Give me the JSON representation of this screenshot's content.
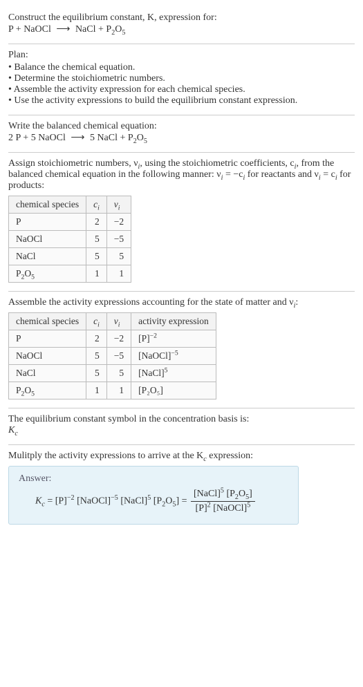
{
  "intro": {
    "line1": "Construct the equilibrium constant, K, expression for:",
    "eq_lhs1": "P",
    "eq_plus": " + ",
    "eq_lhs2": "NaOCl",
    "arrow": "⟶",
    "eq_rhs1": "NaCl",
    "eq_rhs2_a": "P",
    "eq_rhs2_b": "O"
  },
  "plan": {
    "title": "Plan:",
    "items": [
      "• Balance the chemical equation.",
      "• Determine the stoichiometric numbers.",
      "• Assemble the activity expression for each chemical species.",
      "• Use the activity expressions to build the equilibrium constant expression."
    ]
  },
  "balanced": {
    "title": "Write the balanced chemical equation:",
    "c_p": "2 P",
    "c_naocl": "5 NaOCl",
    "c_nacl": "5 NaCl",
    "c_p2o5_p": "P",
    "c_p2o5_o": "O"
  },
  "stoich": {
    "title_a": "Assign stoichiometric numbers, ν",
    "title_b": ", using the stoichiometric coefficients, c",
    "title_c": ", from the balanced chemical equation in the following manner: ν",
    "eq1": " = −c",
    "title_d": " for reactants and ν",
    "eq2": " = c",
    "title_e": " for products:"
  },
  "table1": {
    "h1": "chemical species",
    "h2_a": "c",
    "h3_a": "ν",
    "sub_i": "i",
    "rows": [
      {
        "sp": "P",
        "c": "2",
        "v": "−2"
      },
      {
        "sp": "NaOCl",
        "c": "5",
        "v": "−5"
      },
      {
        "sp": "NaCl",
        "c": "5",
        "v": "5"
      },
      {
        "sp_a": "P",
        "sp_b": "O",
        "c": "1",
        "v": "1"
      }
    ]
  },
  "assemble": {
    "title_a": "Assemble the activity expressions accounting for the state of matter and ν",
    "title_b": ":"
  },
  "table2": {
    "h1": "chemical species",
    "h4": "activity expression",
    "rows": [
      {
        "sp": "P",
        "c": "2",
        "v": "−2",
        "ae_base": "[P]",
        "ae_exp": "−2"
      },
      {
        "sp": "NaOCl",
        "c": "5",
        "v": "−5",
        "ae_base": "[NaOCl]",
        "ae_exp": "−5"
      },
      {
        "sp": "NaCl",
        "c": "5",
        "v": "5",
        "ae_base": "[NaCl]",
        "ae_exp": "5"
      },
      {
        "sp_a": "P",
        "sp_b": "O",
        "c": "1",
        "v": "1",
        "ae_full": "[P₂O₅]"
      }
    ]
  },
  "symbol": {
    "line1": "The equilibrium constant symbol in the concentration basis is:",
    "kc_k": "K",
    "kc_c": "c"
  },
  "multiply": {
    "line_a": "Mulitply the activity expressions to arrive at the K",
    "line_b": " expression:"
  },
  "answer": {
    "label": "Answer:",
    "kc_k": "K",
    "kc_c": "c",
    "eq": " = ",
    "t1": "[P]",
    "e1": "−2",
    "t2": " [NaOCl]",
    "e2": "−5",
    "t3": " [NaCl]",
    "e3": "5",
    "t4": " [P",
    "t4b": "O",
    "t4c": "] = ",
    "num_a": "[NaCl]",
    "num_ae": "5",
    "num_b": " [P",
    "num_c": "O",
    "num_d": "]",
    "den_a": "[P]",
    "den_ae": "2",
    "den_b": " [NaOCl]",
    "den_be": "5"
  }
}
